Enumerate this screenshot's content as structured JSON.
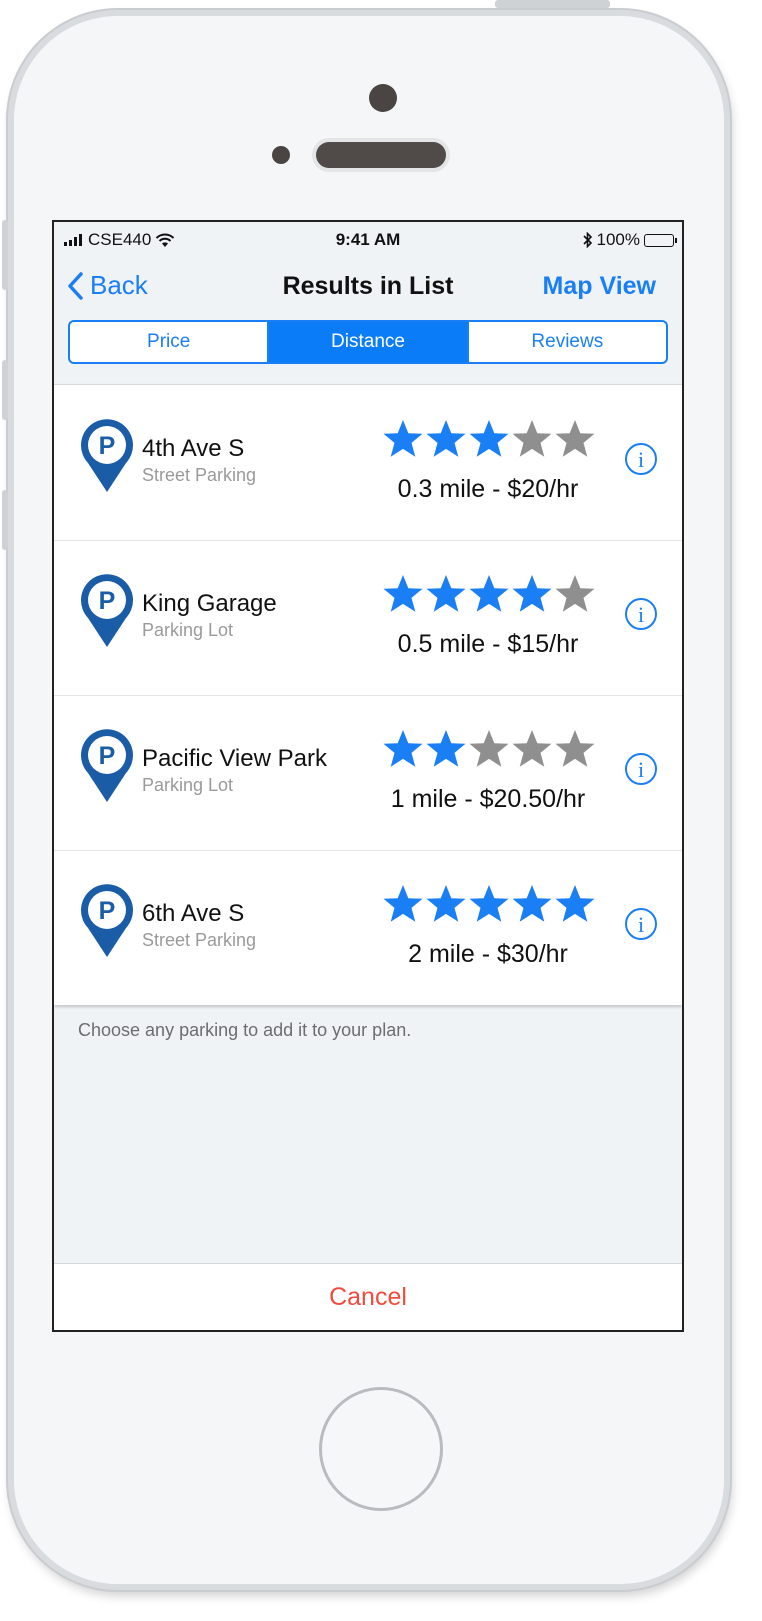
{
  "status_bar": {
    "carrier": "CSE440",
    "time": "9:41 AM",
    "battery": "100%"
  },
  "nav": {
    "back_label": "Back",
    "title": "Results in List",
    "map_view_label": "Map View"
  },
  "segments": [
    {
      "label": "Price",
      "active": false
    },
    {
      "label": "Distance",
      "active": true
    },
    {
      "label": "Reviews",
      "active": false
    }
  ],
  "results": [
    {
      "name": "4th Ave S",
      "type": "Street Parking",
      "rating": 3,
      "max_rating": 5,
      "distance_price": "0.3 mile - $20/hr",
      "pin_letter": "P"
    },
    {
      "name": "King Garage",
      "type": "Parking Lot",
      "rating": 4,
      "max_rating": 5,
      "distance_price": "0.5 mile - $15/hr",
      "pin_letter": "P"
    },
    {
      "name": "Pacific View Park",
      "type": "Parking Lot",
      "rating": 2,
      "max_rating": 5,
      "distance_price": "1 mile - $20.50/hr",
      "pin_letter": "P"
    },
    {
      "name": "6th Ave S",
      "type": "Street Parking",
      "rating": 5,
      "max_rating": 5,
      "distance_price": "2 mile - $30/hr",
      "pin_letter": "P"
    }
  ],
  "hint": "Choose any parking to add it to your plan.",
  "cancel_label": "Cancel",
  "info_glyph": "i",
  "icons": {
    "back": "chevron-left-icon",
    "info": "info-circle-icon",
    "pin": "parking-pin-icon",
    "star": "star-icon",
    "wifi": "wifi-icon",
    "bluetooth": "bluetooth-icon",
    "battery": "battery-icon",
    "signal": "signal-icon"
  },
  "colors": {
    "accent": "#1a7ff5",
    "segment_active_bg": "#0a7cf7",
    "star_filled": "#1a7ff5",
    "star_empty": "#8f8f8f",
    "pin": "#1a5ca6",
    "cancel": "#f24b3c"
  }
}
